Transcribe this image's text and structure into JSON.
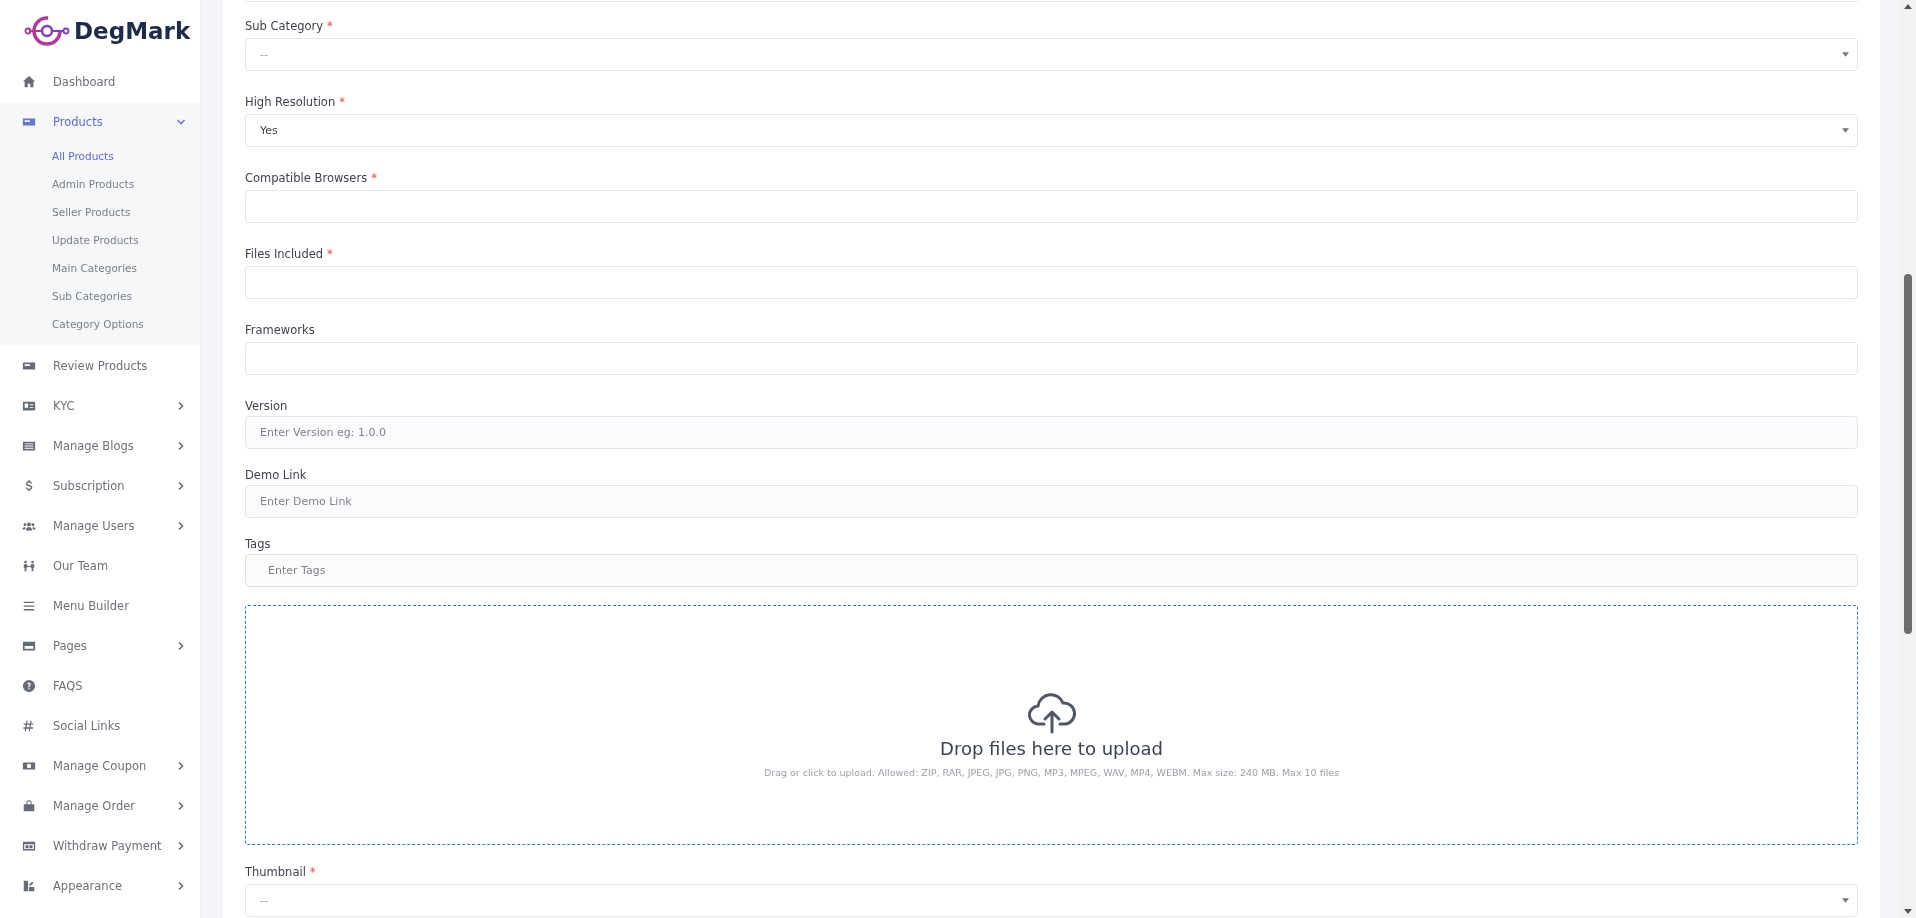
{
  "brand": {
    "name": "DegMark"
  },
  "sidebar": {
    "items": [
      {
        "label": "Dashboard",
        "selected": false,
        "has_submenu": false
      },
      {
        "label": "Products",
        "selected": true,
        "has_submenu": true,
        "expanded": true,
        "children": [
          {
            "label": "All Products",
            "selected": true
          },
          {
            "label": "Admin Products",
            "selected": false
          },
          {
            "label": "Seller Products",
            "selected": false
          },
          {
            "label": "Update Products",
            "selected": false
          },
          {
            "label": "Main Categories",
            "selected": false
          },
          {
            "label": "Sub Categories",
            "selected": false
          },
          {
            "label": "Category Options",
            "selected": false
          }
        ]
      },
      {
        "label": "Review Products",
        "selected": false,
        "has_submenu": false
      },
      {
        "label": "KYC",
        "selected": false,
        "has_submenu": true,
        "expanded": false
      },
      {
        "label": "Manage Blogs",
        "selected": false,
        "has_submenu": true,
        "expanded": false
      },
      {
        "label": "Subscription",
        "selected": false,
        "has_submenu": true,
        "expanded": false
      },
      {
        "label": "Manage Users",
        "selected": false,
        "has_submenu": true,
        "expanded": false
      },
      {
        "label": "Our Team",
        "selected": false,
        "has_submenu": false
      },
      {
        "label": "Menu Builder",
        "selected": false,
        "has_submenu": false
      },
      {
        "label": "Pages",
        "selected": false,
        "has_submenu": true,
        "expanded": false
      },
      {
        "label": "FAQS",
        "selected": false,
        "has_submenu": false
      },
      {
        "label": "Social Links",
        "selected": false,
        "has_submenu": false
      },
      {
        "label": "Manage Coupon",
        "selected": false,
        "has_submenu": true,
        "expanded": false
      },
      {
        "label": "Manage Order",
        "selected": false,
        "has_submenu": true,
        "expanded": false
      },
      {
        "label": "Withdraw Payment",
        "selected": false,
        "has_submenu": true,
        "expanded": false
      },
      {
        "label": "Appearance",
        "selected": false,
        "has_submenu": true,
        "expanded": false
      }
    ]
  },
  "form": {
    "fields": [
      {
        "kind": "select",
        "label": "Sub Category",
        "required_mark": "*",
        "placeholder": "--"
      },
      {
        "kind": "select",
        "label": "High Resolution",
        "required_mark": "*",
        "value": "Yes"
      },
      {
        "kind": "input",
        "label": "Compatible Browsers",
        "required_mark": "*"
      },
      {
        "kind": "input",
        "label": "Files Included",
        "required_mark": "*"
      },
      {
        "kind": "input",
        "label": "Frameworks"
      },
      {
        "kind": "input",
        "label": "Version",
        "placeholder": "Enter Version eg: 1.0.0"
      },
      {
        "kind": "input",
        "label": "Demo Link",
        "placeholder": "Enter Demo Link"
      },
      {
        "kind": "tags",
        "label": "Tags",
        "placeholder": "Enter Tags"
      },
      {
        "kind": "dropzone",
        "title": "Drop files here to upload",
        "hint": "Drag or click to upload. Allowed: ZIP, RAR, JPEG, JPG, PNG, MP3, MPEG, WAV, MP4, WEBM. Max size: 240 MB. Max 10 files"
      },
      {
        "kind": "select",
        "label": "Thumbnail",
        "required_mark": "*",
        "placeholder": "--"
      }
    ]
  }
}
